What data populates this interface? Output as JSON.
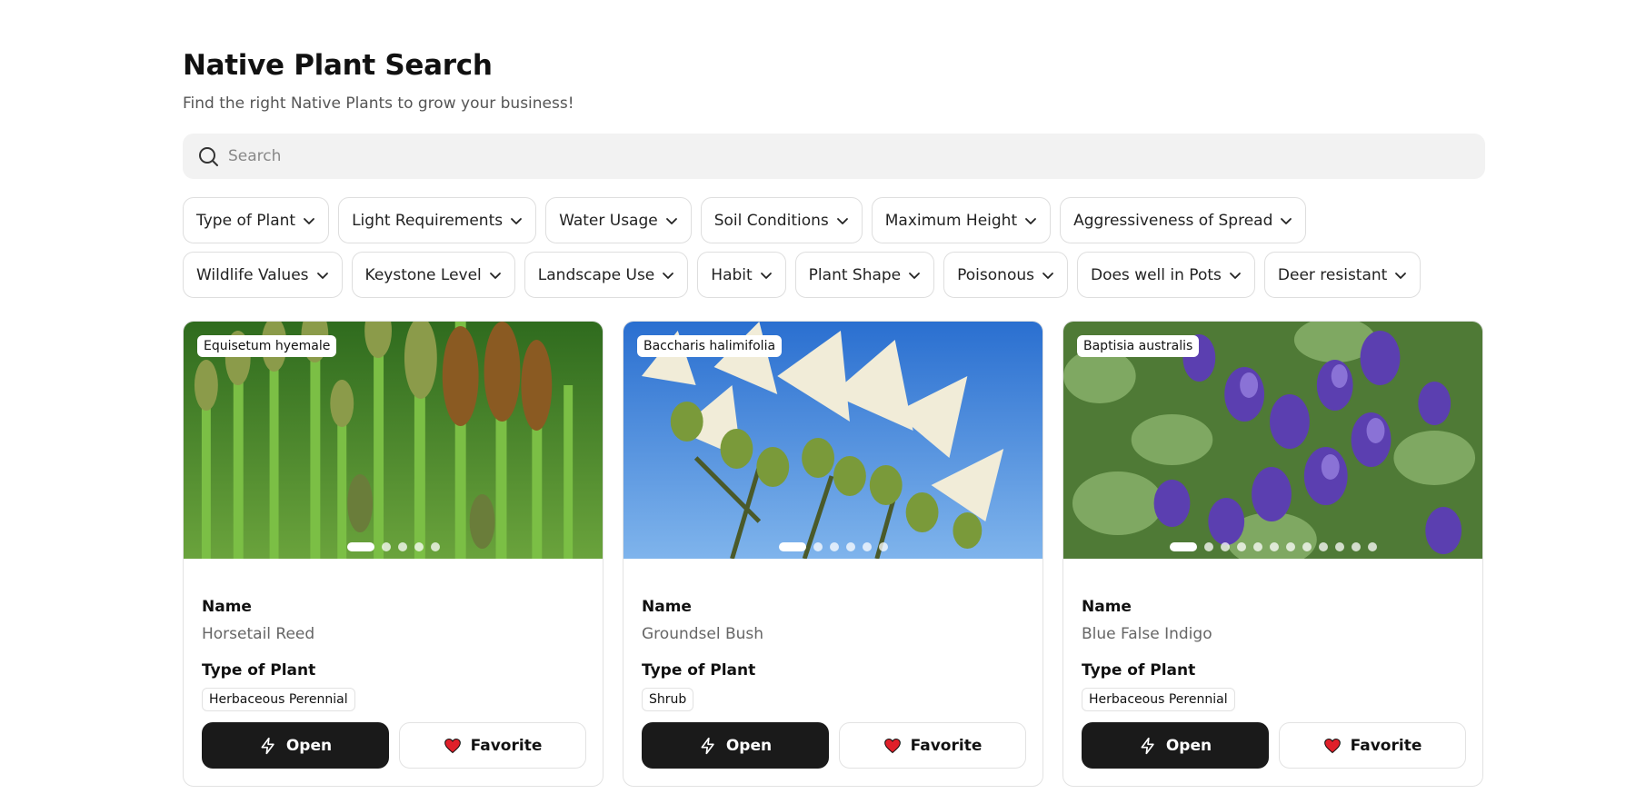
{
  "header": {
    "title": "Native Plant Search",
    "subtitle": "Find the right Native Plants to grow your business!"
  },
  "search": {
    "placeholder": "Search",
    "icon": "search-icon"
  },
  "filters": {
    "row1": [
      "Type of Plant",
      "Light Requirements",
      "Water Usage",
      "Soil Conditions",
      "Maximum Height",
      "Aggressiveness of Spread"
    ],
    "row2": [
      "Wildlife Values",
      "Keystone Level",
      "Landscape Use",
      "Habit",
      "Plant Shape",
      "Poisonous",
      "Does well in Pots",
      "Deer resistant"
    ]
  },
  "card_labels": {
    "name": "Name",
    "type": "Type of Plant",
    "open": "Open",
    "favorite": "Favorite"
  },
  "cards": [
    {
      "scientific_name": "Equisetum hyemale",
      "name": "Horsetail Reed",
      "type": "Herbaceous Perennial",
      "image_count": 5,
      "active_image": 0
    },
    {
      "scientific_name": "Baccharis halimifolia",
      "name": "Groundsel Bush",
      "type": "Shrub",
      "image_count": 6,
      "active_image": 0
    },
    {
      "scientific_name": "Baptisia australis",
      "name": "Blue False Indigo",
      "type": "Herbaceous Perennial",
      "image_count": 12,
      "active_image": 0
    }
  ],
  "colors": {
    "primary_button": "#1a1a1a",
    "heart": "#e0202a",
    "search_bg": "#f2f2f2"
  }
}
